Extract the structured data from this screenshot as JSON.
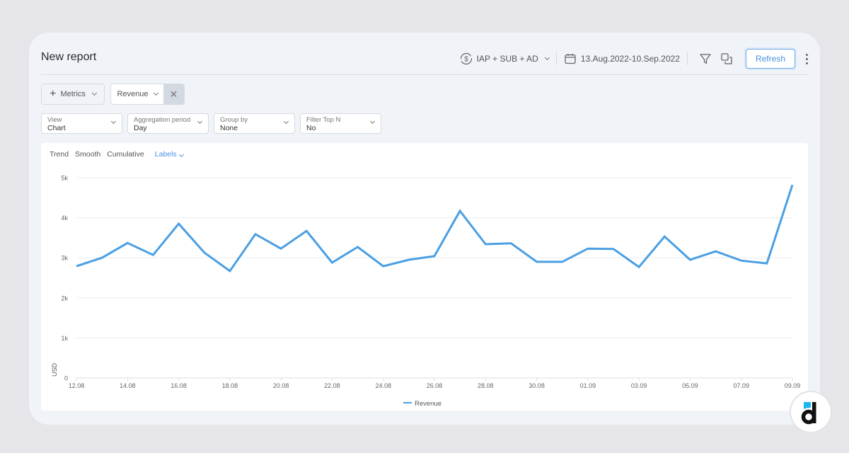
{
  "header": {
    "title": "New report",
    "revenue_source": "IAP + SUB + AD",
    "date_range": "13.Aug.2022-10.Sep.2022",
    "refresh_label": "Refresh"
  },
  "metrics": {
    "add_label": "Metrics",
    "selected": [
      {
        "label": "Revenue"
      }
    ]
  },
  "selects": [
    {
      "label": "View",
      "value": "Chart"
    },
    {
      "label": "Aggregation period",
      "value": "Day"
    },
    {
      "label": "Group by",
      "value": "None"
    },
    {
      "label": "Filter Top N",
      "value": "No"
    }
  ],
  "chart_options": {
    "trend": "Trend",
    "smooth": "Smooth",
    "cumulative": "Cumulative",
    "labels": "Labels"
  },
  "colors": {
    "series": "#4a9fe3",
    "accent": "#4a90e2"
  },
  "chart_data": {
    "type": "line",
    "title": "",
    "xlabel": "",
    "ylabel": "USD",
    "ylim": [
      0,
      5000
    ],
    "yticks": [
      0,
      1000,
      2000,
      3000,
      4000,
      5000
    ],
    "ytick_labels": [
      "0",
      "1k",
      "2k",
      "3k",
      "4k",
      "5k"
    ],
    "x": [
      "12.08",
      "13.08",
      "14.08",
      "15.08",
      "16.08",
      "17.08",
      "18.08",
      "19.08",
      "20.08",
      "21.08",
      "22.08",
      "23.08",
      "24.08",
      "25.08",
      "26.08",
      "27.08",
      "28.08",
      "29.08",
      "30.08",
      "31.08",
      "01.09",
      "02.09",
      "03.09",
      "04.09",
      "05.09",
      "06.09",
      "07.09",
      "08.09",
      "09.09"
    ],
    "xtick_labels": [
      "12.08",
      "14.08",
      "16.08",
      "18.08",
      "20.08",
      "22.08",
      "24.08",
      "26.08",
      "28.08",
      "30.08",
      "01.09",
      "03.09",
      "05.09",
      "07.09",
      "09.09"
    ],
    "grid": true,
    "legend": "bottom-center",
    "series": [
      {
        "name": "Revenue",
        "values": [
          2790,
          3000,
          3370,
          3070,
          3850,
          3130,
          2670,
          3590,
          3230,
          3670,
          2880,
          3270,
          2790,
          2950,
          3040,
          4170,
          3340,
          3360,
          2900,
          2900,
          3230,
          3220,
          2770,
          3530,
          2950,
          3160,
          2930,
          2860,
          4820
        ]
      }
    ]
  }
}
